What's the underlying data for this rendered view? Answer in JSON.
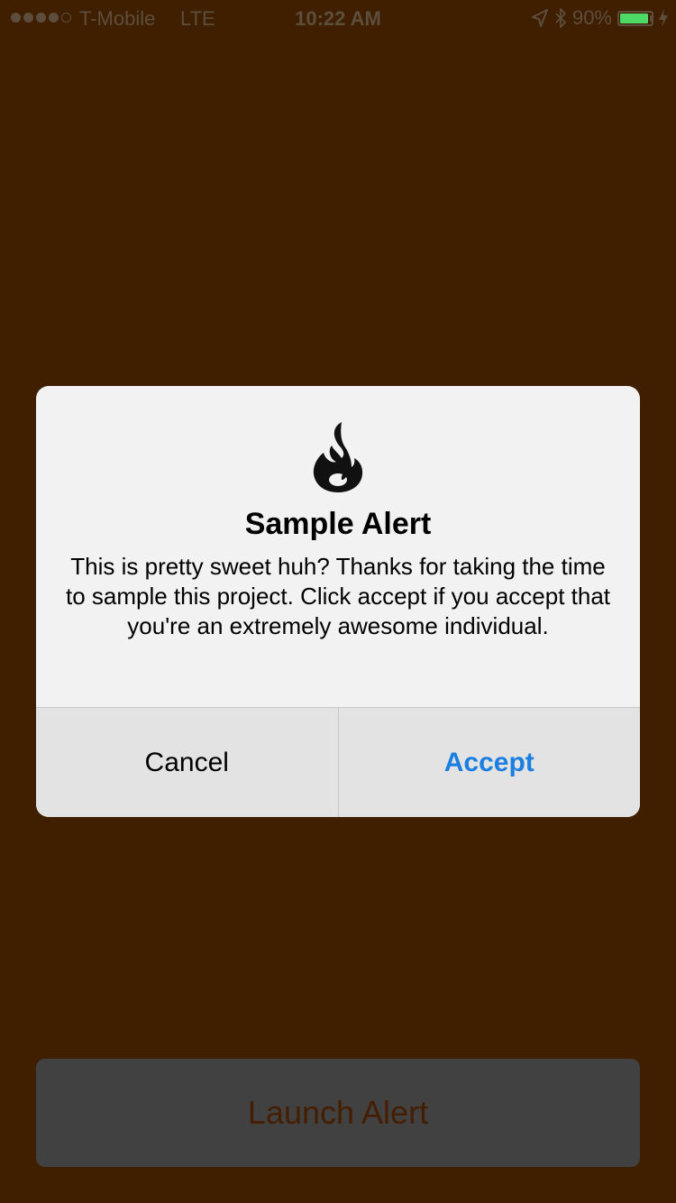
{
  "status_bar": {
    "carrier": "T-Mobile",
    "network": "LTE",
    "time": "10:22 AM",
    "battery_percent_label": "90%",
    "battery_level": 0.9,
    "signal_bars": 4,
    "signal_max": 5,
    "icons": [
      "location-arrow-icon",
      "bluetooth-icon",
      "battery-icon",
      "charging-bolt-icon"
    ]
  },
  "alert": {
    "icon": "flame-icon",
    "title": "Sample Alert",
    "message": "This is pretty sweet huh? Thanks for taking the time to sample this project. Click accept if you accept that you're an extremely awesome individual.",
    "cancel_label": "Cancel",
    "accept_label": "Accept"
  },
  "main": {
    "launch_label": "Launch Alert"
  },
  "colors": {
    "background": "#401f01",
    "alert_bg": "#f2f2f2",
    "accent": "#1a7fe0",
    "launch_bg": "#414141",
    "launch_text": "#451d00",
    "battery_fill": "#4cd964"
  }
}
